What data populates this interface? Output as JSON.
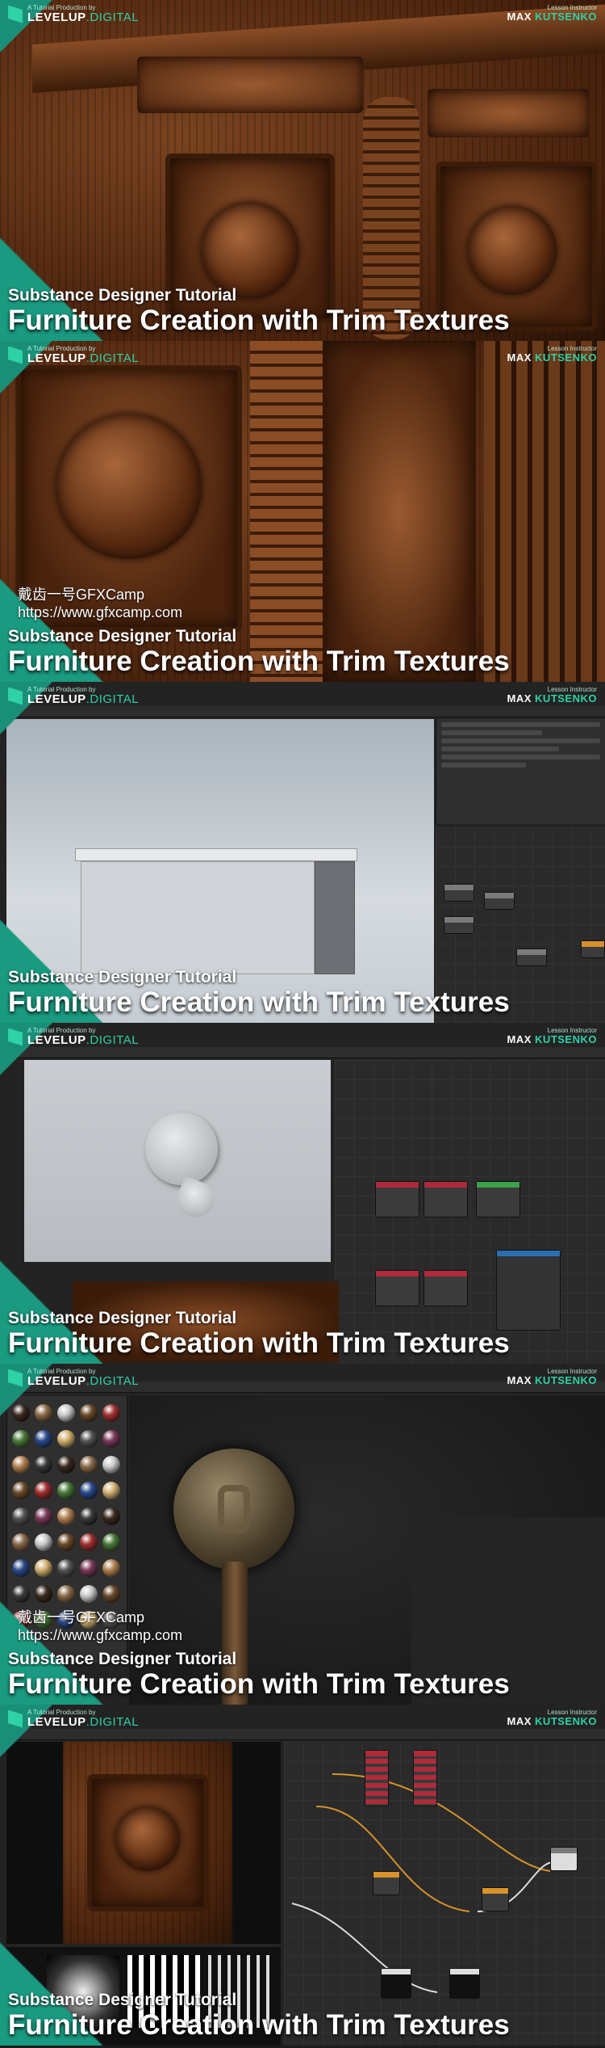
{
  "branding": {
    "tagline": "A Tutorial Production by",
    "name_bold": "LEVELUP",
    "name_accent": ".DIGITAL",
    "instructor_role": "Lesson Instructor",
    "instructor_first": "MAX",
    "instructor_last": "KUTSENKO"
  },
  "caption": {
    "sub": "Substance Designer Tutorial",
    "main": "Furniture Creation with Trim Textures"
  },
  "watermark": {
    "line1": "戴齿一号GFXCamp",
    "line2": "https://www.gfxcamp.com"
  },
  "colors": {
    "accent": "#2fd1a6",
    "teal_wedge": "#1a9a80",
    "ui_dark": "#232323"
  },
  "panels": [
    {
      "id": "cabinet-render",
      "show_watermark": false
    },
    {
      "id": "carving-closeup",
      "show_watermark": true
    },
    {
      "id": "blockout-viewport",
      "show_watermark": false
    },
    {
      "id": "sculpt-graph",
      "show_watermark": false
    },
    {
      "id": "handle-material-library",
      "show_watermark": true
    },
    {
      "id": "door-panel-graph",
      "show_watermark": false
    }
  ]
}
